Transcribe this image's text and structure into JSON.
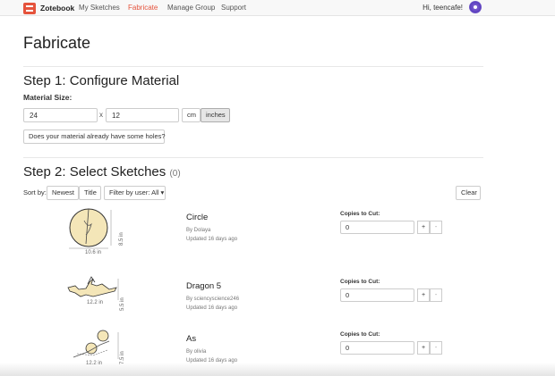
{
  "nav": {
    "brand": "Zotebook",
    "links": [
      "My Sketches",
      "Fabricate",
      "Manage Group",
      "Support"
    ],
    "greeting": "Hi, teencafe!"
  },
  "page": {
    "title": "Fabricate"
  },
  "step1": {
    "title": "Step 1: Configure Material",
    "material_size_label": "Material Size:",
    "width_value": "24",
    "times": "x",
    "height_value": "12",
    "unit_cm": "cm",
    "unit_inches": "inches",
    "selected_unit": "inches",
    "holes_button": "Does your material already have some holes?"
  },
  "step2": {
    "title": "Step 2: Select Sketches",
    "count": "(0)",
    "sort_label": "Sort by:",
    "sort_newest": "Newest",
    "sort_title": "Title",
    "filter": "Filter by user: All",
    "clear": "Clear"
  },
  "sketches": [
    {
      "title": "Circle",
      "author": "By Dolaya",
      "updated": "Updated 16 days ago",
      "width": "10.6 in",
      "height": "8.5 in",
      "copies_label": "Copies to Cut:",
      "copies": "0"
    },
    {
      "title": "Dragon 5",
      "author": "By sciencyscience246",
      "updated": "Updated 16 days ago",
      "width": "12.2 in",
      "height": "5.5 in",
      "copies_label": "Copies to Cut:",
      "copies": "0"
    },
    {
      "title": "As",
      "author": "By olivia",
      "updated": "Updated 16 days ago",
      "width": "12.2 in",
      "height": "7.5 in",
      "copies_label": "Copies to Cut:",
      "copies": "0"
    }
  ],
  "stepper": {
    "plus": "+",
    "minus": "-"
  },
  "colors": {
    "accent": "#e5533c",
    "circle_fill": "#f4e6b8"
  }
}
